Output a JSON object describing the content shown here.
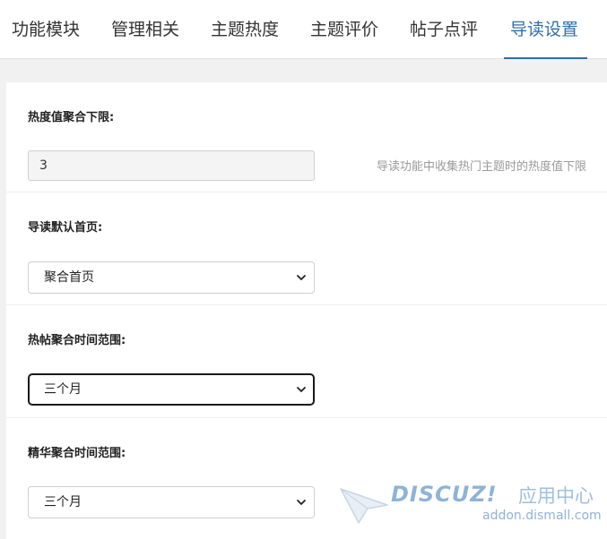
{
  "tabs": [
    {
      "label": "功能模块",
      "active": false
    },
    {
      "label": "管理相关",
      "active": false
    },
    {
      "label": "主题热度",
      "active": false
    },
    {
      "label": "主题评价",
      "active": false
    },
    {
      "label": "帖子点评",
      "active": false
    },
    {
      "label": "导读设置",
      "active": true
    }
  ],
  "accent_color": "#2f6fa8",
  "settings": {
    "heat_limit": {
      "label": "热度值聚合下限:",
      "value": "3",
      "hint": "导读功能中收集热门主题时的热度值下限"
    },
    "default_home": {
      "label": "导读默认首页:",
      "value": "聚合首页"
    },
    "hot_range": {
      "label": "热帖聚合时间范围:",
      "value": "三个月"
    },
    "digest_range": {
      "label": "精华聚合时间范围:",
      "value": "三个月"
    }
  },
  "watermark": {
    "brand": "DISCUZ!",
    "suffix": "应用中心",
    "domain": "addon.dismall.com"
  }
}
